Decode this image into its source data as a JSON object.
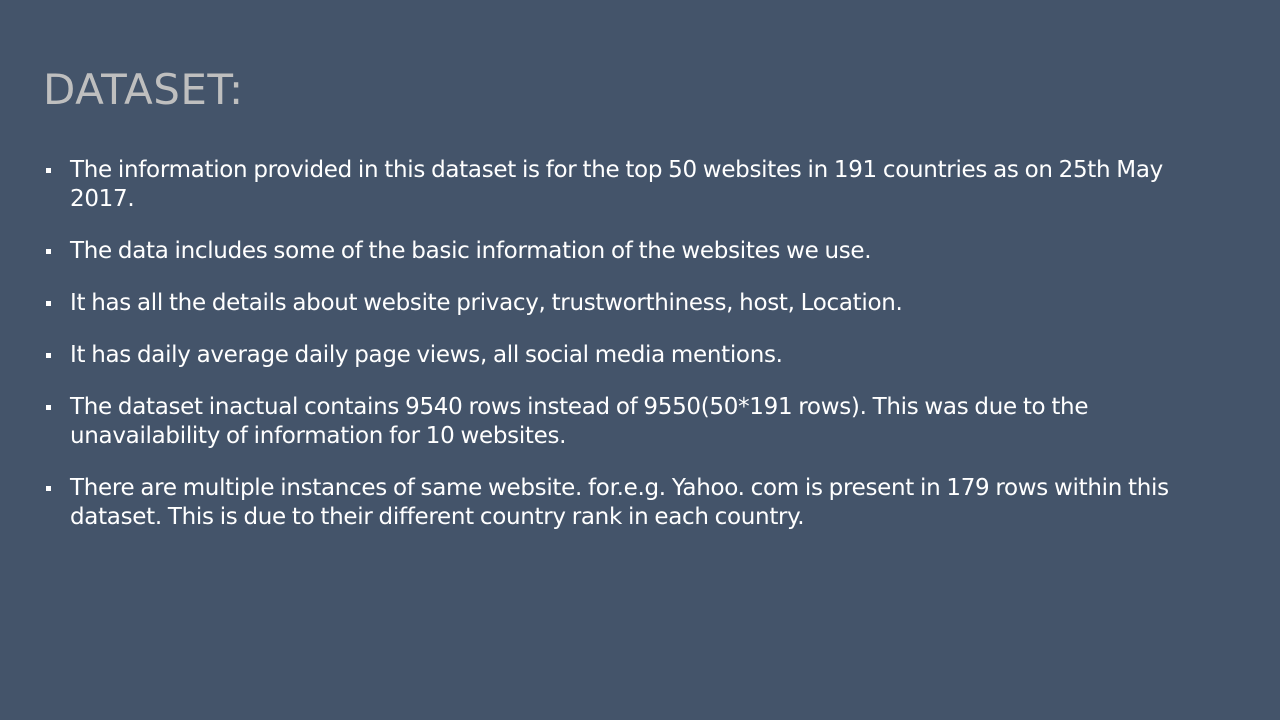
{
  "slide": {
    "title": "DATASET:",
    "bullets": [
      "The information provided in this dataset is for the top 50 websites in 191 countries as on 25th May 2017.",
      "The data includes some of the basic information of the websites we use.",
      "It has all the details about website privacy, trustworthiness, host, Location.",
      "It has daily average daily page views, all social media mentions.",
      "The dataset inactual contains 9540 rows instead of 9550(50*191 rows). This was due to the unavailability of information for 10 websites.",
      "There are multiple instances of same website. for.e.g. Yahoo. com is present in 179 rows within this dataset. This is due to their different country rank in each country."
    ]
  },
  "colors": {
    "background": "#44546a",
    "title": "#bfbfbf",
    "text": "#ffffff"
  }
}
